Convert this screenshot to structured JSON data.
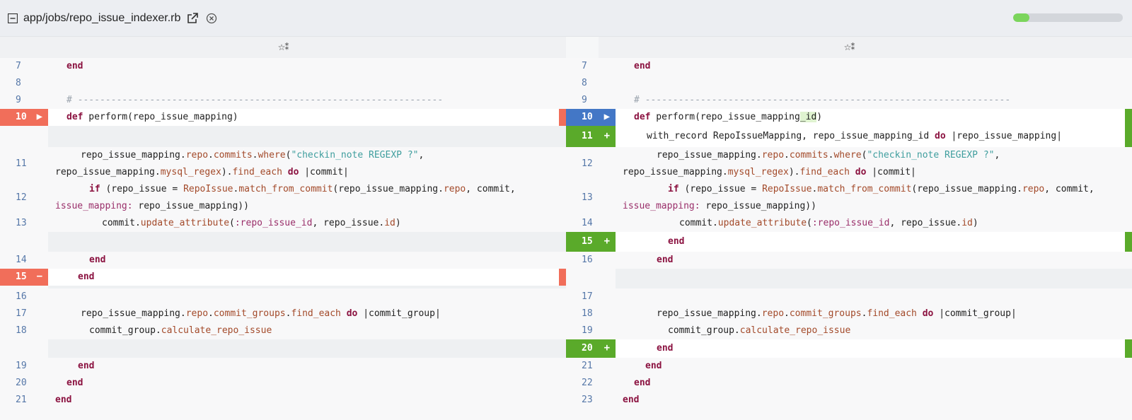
{
  "file": {
    "path": "app/jobs/repo_issue_indexer.rb"
  },
  "progress": 0.15,
  "colors": {
    "deleted": "#f16e5a",
    "modified_left": "#f16e5a",
    "modified_right": "#4377c6",
    "added": "#5aaa2a",
    "progress_fill": "#7bd55c"
  },
  "left": {
    "header_glyph": "☆⁑",
    "lines": [
      {
        "num": "7",
        "text": "end"
      },
      {
        "num": "8",
        "text": ""
      },
      {
        "num": "9",
        "text": "# ------------------------------------------------------------------"
      },
      {
        "num": "10",
        "text": "def perform(repo_issue_mapping)"
      },
      {
        "num": "11",
        "text": "repo_issue_mapping.repo.commits.where(\"checkin_note REGEXP ?\", repo_issue_mapping.mysql_regex).find_each do |commit|"
      },
      {
        "num": "12",
        "text": "if (repo_issue = RepoIssue.match_from_commit(repo_issue_mapping.repo, commit, issue_mapping: repo_issue_mapping))"
      },
      {
        "num": "13",
        "text": "commit.update_attribute(:repo_issue_id, repo_issue.id)"
      },
      {
        "num": "14",
        "text": "end"
      },
      {
        "num": "15",
        "text": "end"
      },
      {
        "num": "16",
        "text": ""
      },
      {
        "num": "17",
        "text": "repo_issue_mapping.repo.commit_groups.find_each do |commit_group|"
      },
      {
        "num": "18",
        "text": "commit_group.calculate_repo_issue"
      },
      {
        "num": "19",
        "text": "end"
      },
      {
        "num": "20",
        "text": "end"
      },
      {
        "num": "21",
        "text": "end"
      }
    ]
  },
  "right": {
    "header_glyph": "☆⁑",
    "lines": [
      {
        "num": "7",
        "text": "end"
      },
      {
        "num": "8",
        "text": ""
      },
      {
        "num": "9",
        "text": "# ------------------------------------------------------------------"
      },
      {
        "num": "10",
        "text": "def perform(repo_issue_mapping_id)"
      },
      {
        "num": "11",
        "text": "with_record RepoIssueMapping, repo_issue_mapping_id do |repo_issue_mapping|"
      },
      {
        "num": "12",
        "text": "repo_issue_mapping.repo.commits.where(\"checkin_note REGEXP ?\", repo_issue_mapping.mysql_regex).find_each do |commit|"
      },
      {
        "num": "13",
        "text": "if (repo_issue = RepoIssue.match_from_commit(repo_issue_mapping.repo, commit, issue_mapping: repo_issue_mapping))"
      },
      {
        "num": "14",
        "text": "commit.update_attribute(:repo_issue_id, repo_issue.id)"
      },
      {
        "num": "15",
        "text": "end"
      },
      {
        "num": "16",
        "text": "end"
      },
      {
        "num": "17",
        "text": ""
      },
      {
        "num": "18",
        "text": "repo_issue_mapping.repo.commit_groups.find_each do |commit_group|"
      },
      {
        "num": "19",
        "text": "commit_group.calculate_repo_issue"
      },
      {
        "num": "20",
        "text": "end"
      },
      {
        "num": "21",
        "text": "end"
      },
      {
        "num": "22",
        "text": "end"
      },
      {
        "num": "23",
        "text": "end"
      }
    ]
  },
  "markers": {
    "added": "+",
    "deleted": "−",
    "modified": "▶"
  }
}
